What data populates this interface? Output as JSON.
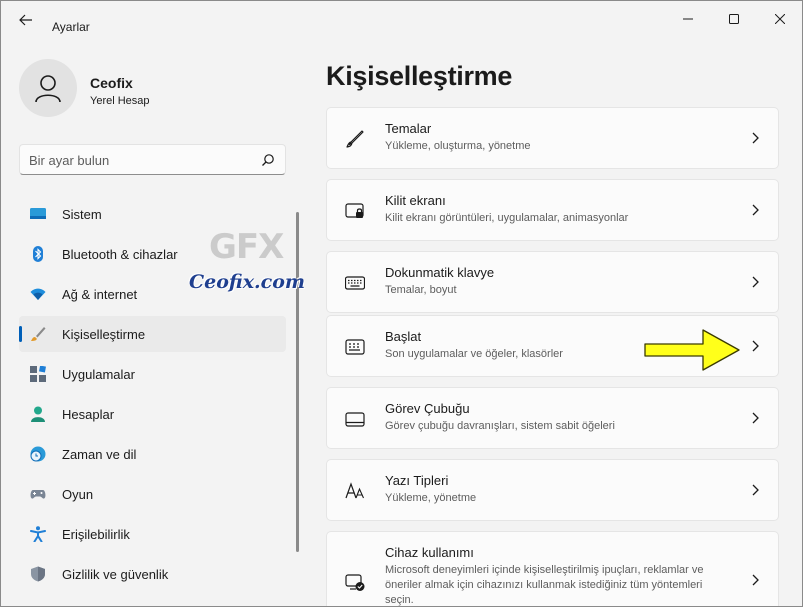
{
  "window": {
    "title": "Ayarlar"
  },
  "profile": {
    "name": "Ceofix",
    "account_type": "Yerel Hesap"
  },
  "search": {
    "placeholder": "Bir ayar bulun"
  },
  "nav": {
    "items": [
      {
        "label": "Sistem",
        "icon": "monitor-icon"
      },
      {
        "label": "Bluetooth & cihazlar",
        "icon": "bluetooth-icon"
      },
      {
        "label": "Ağ & internet",
        "icon": "wifi-icon"
      },
      {
        "label": "Kişiselleştirme",
        "icon": "brush-icon",
        "active": true
      },
      {
        "label": "Uygulamalar",
        "icon": "apps-icon"
      },
      {
        "label": "Hesaplar",
        "icon": "person-icon"
      },
      {
        "label": "Zaman ve dil",
        "icon": "globe-clock-icon"
      },
      {
        "label": "Oyun",
        "icon": "gamepad-icon"
      },
      {
        "label": "Erişilebilirlik",
        "icon": "accessibility-icon"
      },
      {
        "label": "Gizlilik ve güvenlik",
        "icon": "shield-icon"
      }
    ]
  },
  "watermark": {
    "logo": "GFX",
    "site": "Ceofix.com"
  },
  "main": {
    "title": "Kişiselleştirme",
    "cards": [
      {
        "title": "Temalar",
        "desc": "Yükleme, oluşturma, yönetme",
        "icon": "pen-icon"
      },
      {
        "title": "Kilit ekranı",
        "desc": "Kilit ekranı görüntüleri, uygulamalar, animasyonlar",
        "icon": "lock-screen-icon"
      },
      {
        "title": "Dokunmatik klavye",
        "desc": "Temalar, boyut",
        "icon": "keyboard-icon"
      },
      {
        "title": "Başlat",
        "desc": "Son uygulamalar ve öğeler, klasörler",
        "icon": "start-menu-icon"
      },
      {
        "title": "Görev Çubuğu",
        "desc": "Görev çubuğu davranışları, sistem sabit öğeleri",
        "icon": "taskbar-icon"
      },
      {
        "title": "Yazı Tipleri",
        "desc": "Yükleme, yönetme",
        "icon": "font-icon"
      },
      {
        "title": "Cihaz kullanımı",
        "desc": "Microsoft deneyimleri içinde kişiselleştirilmiş ipuçları, reklamlar ve öneriler almak için cihazınızı kullanmak istediğiniz tüm yöntemleri seçin.",
        "icon": "device-usage-icon"
      }
    ]
  },
  "colors": {
    "accent": "#005fb8",
    "arrow": "#ffff1a",
    "watermark_text": "#1f3f8f"
  }
}
